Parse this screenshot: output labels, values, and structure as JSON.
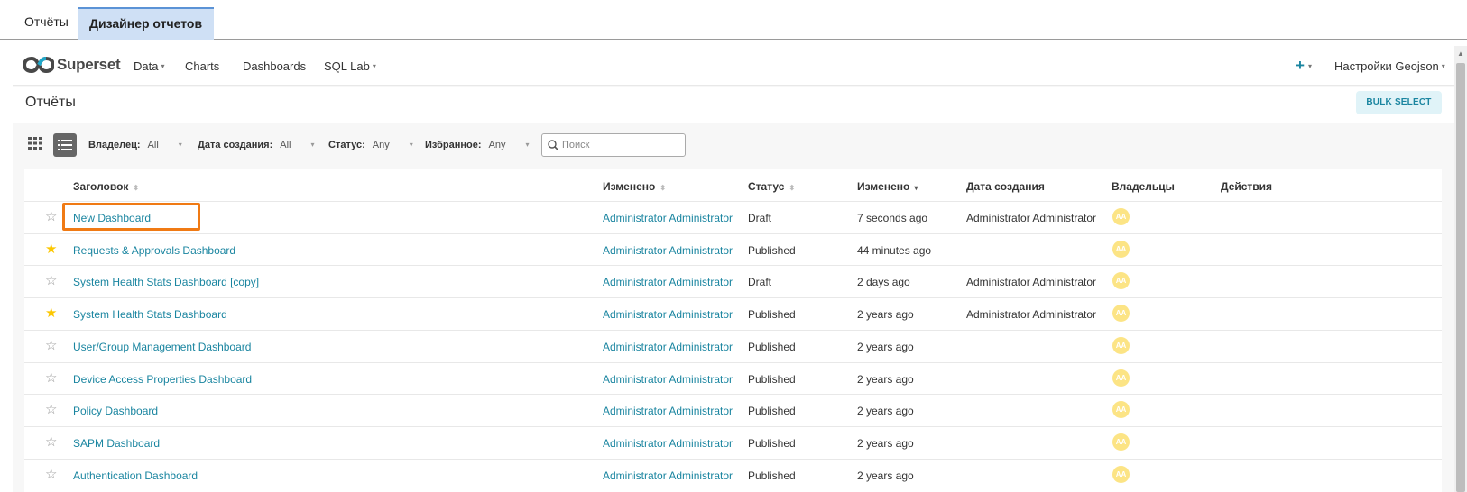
{
  "app_tabs": [
    "Отчёты",
    "Дизайнер отчетов"
  ],
  "navbar": {
    "brand": "Superset",
    "items": [
      {
        "label": "Data",
        "dropdown": true
      },
      {
        "label": "Charts",
        "dropdown": false
      },
      {
        "label": "Dashboards",
        "dropdown": false
      },
      {
        "label": "SQL Lab",
        "dropdown": true
      }
    ],
    "plus": "+",
    "settings_label": "Настройки Geojson"
  },
  "subheader": {
    "title": "Отчёты",
    "bulk_select": "BULK SELECT"
  },
  "filters": [
    {
      "label": "Владелец:",
      "value": "All"
    },
    {
      "label": "Дата создания:",
      "value": "All"
    },
    {
      "label": "Статус:",
      "value": "Any"
    },
    {
      "label": "Избранное:",
      "value": "Any"
    }
  ],
  "search": {
    "placeholder": "Поиск",
    "value": ""
  },
  "table": {
    "columns": [
      "Заголовок",
      "Изменено",
      "Статус",
      "Изменено",
      "Дата создания",
      "Владельцы",
      "Действия"
    ],
    "rows": [
      {
        "favorite": false,
        "title": "New Dashboard",
        "modified_by": "Administrator Administrator",
        "status": "Draft",
        "modified": "7 seconds ago",
        "created_by": "Administrator Administrator",
        "owner": "AA"
      },
      {
        "favorite": true,
        "title": "Requests & Approvals Dashboard",
        "modified_by": "Administrator Administrator",
        "status": "Published",
        "modified": "44 minutes ago",
        "created_by": "",
        "owner": "AA"
      },
      {
        "favorite": false,
        "title": "System Health Stats Dashboard [copy]",
        "modified_by": "Administrator Administrator",
        "status": "Draft",
        "modified": "2 days ago",
        "created_by": "Administrator Administrator",
        "owner": "AA"
      },
      {
        "favorite": true,
        "title": "System Health Stats Dashboard",
        "modified_by": "Administrator Administrator",
        "status": "Published",
        "modified": "2 years ago",
        "created_by": "Administrator Administrator",
        "owner": "AA"
      },
      {
        "favorite": false,
        "title": "User/Group Management Dashboard",
        "modified_by": "Administrator Administrator",
        "status": "Published",
        "modified": "2 years ago",
        "created_by": "",
        "owner": "AA"
      },
      {
        "favorite": false,
        "title": "Device Access Properties Dashboard",
        "modified_by": "Administrator Administrator",
        "status": "Published",
        "modified": "2 years ago",
        "created_by": "",
        "owner": "AA"
      },
      {
        "favorite": false,
        "title": "Policy Dashboard",
        "modified_by": "Administrator Administrator",
        "status": "Published",
        "modified": "2 years ago",
        "created_by": "",
        "owner": "AA"
      },
      {
        "favorite": false,
        "title": "SAPM Dashboard",
        "modified_by": "Administrator Administrator",
        "status": "Published",
        "modified": "2 years ago",
        "created_by": "",
        "owner": "AA"
      },
      {
        "favorite": false,
        "title": "Authentication Dashboard",
        "modified_by": "Administrator Administrator",
        "status": "Published",
        "modified": "2 years ago",
        "created_by": "",
        "owner": "AA"
      }
    ]
  },
  "colors": {
    "accent": "#1a85a0",
    "star_on": "#fcc700",
    "avatar": "#fce485",
    "highlight": "#f07a14"
  }
}
